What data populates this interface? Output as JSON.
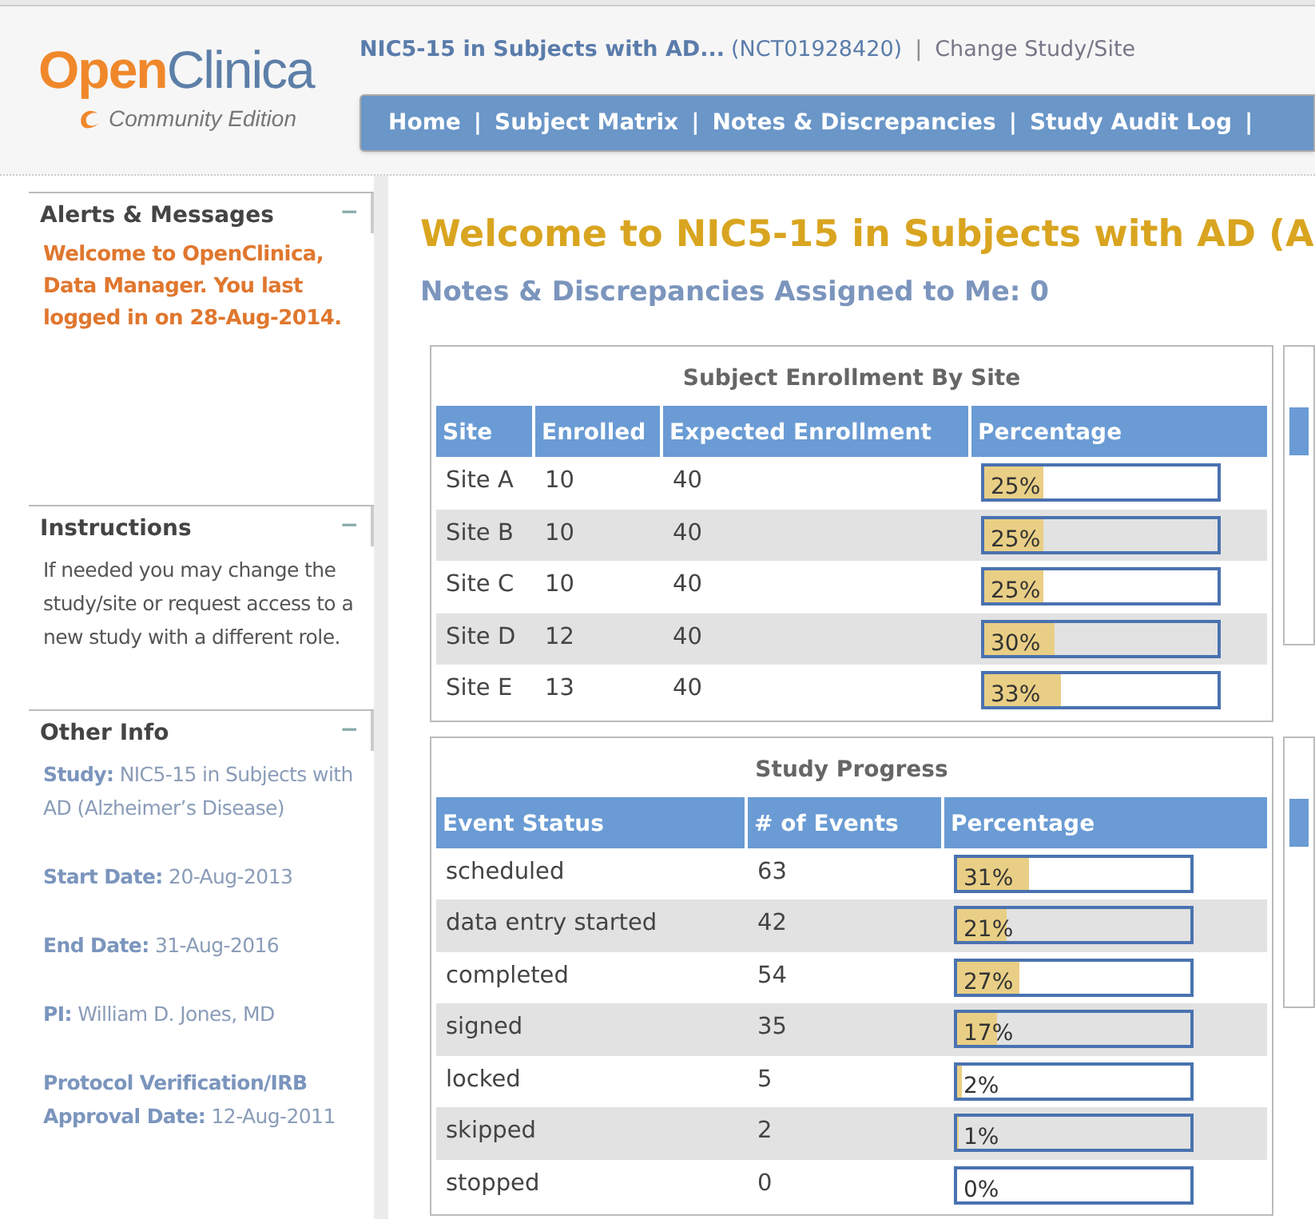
{
  "header": {
    "logo_open": "Open",
    "logo_clinica": "Clinica",
    "edition": "Community Edition",
    "study_name": "NIC5-15 in Subjects with AD...",
    "study_id": "(NCT01928420)",
    "separator": "|",
    "change_link": "Change Study/Site"
  },
  "nav": {
    "separator": "|",
    "items": [
      "Home",
      "Subject Matrix",
      "Notes & Discrepancies",
      "Study Audit Log"
    ]
  },
  "sidebar": [
    {
      "kind": "message",
      "title": "Alerts & Messages",
      "toggle": "−",
      "text": "Welcome to OpenClinica, Data Manager. You last logged in on 28-Aug-2014."
    },
    {
      "kind": "text",
      "title": "Instructions",
      "toggle": "−",
      "text": "If needed you may change the study/site or request access to a new study with a different role."
    },
    {
      "kind": "info",
      "title": "Other Info",
      "toggle": "−",
      "items": [
        "**Study:** NIC5-15 in Subjects with AD (Alzheimer’s Disease)",
        "**Start Date:** 20-Aug-2013",
        "**End Date:** 31-Aug-2016",
        "**PI:** William D. Jones, MD",
        "**Protocol Verification/IRB Approval Date:** 12-Aug-2011"
      ]
    }
  ],
  "main": {
    "title": "Welcome to NIC5-15 in Subjects with AD (A",
    "assigned": "Notes & Discrepancies Assigned to Me: 0",
    "tables": [
      {
        "title": "Subject Enrollment By Site",
        "columns": [
          "Site",
          "Enrolled",
          "Expected Enrollment",
          "Percentage"
        ],
        "rows": [
          {
            "cells": [
              "Site A",
              "10",
              "40"
            ],
            "percent": "25%",
            "level": 0.25
          },
          {
            "cells": [
              "Site B",
              "10",
              "40"
            ],
            "percent": "25%",
            "level": 0.25
          },
          {
            "cells": [
              "Site C",
              "10",
              "40"
            ],
            "percent": "25%",
            "level": 0.25
          },
          {
            "cells": [
              "Site D",
              "12",
              "40"
            ],
            "percent": "30%",
            "level": 0.3
          },
          {
            "cells": [
              "Site E",
              "13",
              "40"
            ],
            "percent": "33%",
            "level": 0.33
          }
        ]
      },
      {
        "title": "Study Progress",
        "columns": [
          "Event Status",
          "# of Events",
          "Percentage"
        ],
        "rows": [
          {
            "cells": [
              "scheduled",
              "63"
            ],
            "percent": "31%",
            "level": 0.31
          },
          {
            "cells": [
              "data entry started",
              "42"
            ],
            "percent": "21%",
            "level": 0.21
          },
          {
            "cells": [
              "completed",
              "54"
            ],
            "percent": "27%",
            "level": 0.27
          },
          {
            "cells": [
              "signed",
              "35"
            ],
            "percent": "17%",
            "level": 0.17
          },
          {
            "cells": [
              "locked",
              "5"
            ],
            "percent": "2%",
            "level": 0.02
          },
          {
            "cells": [
              "skipped",
              "2"
            ],
            "percent": "1%",
            "level": 0.01
          },
          {
            "cells": [
              "stopped",
              "0"
            ],
            "percent": "0%",
            "level": 0
          }
        ]
      }
    ]
  }
}
